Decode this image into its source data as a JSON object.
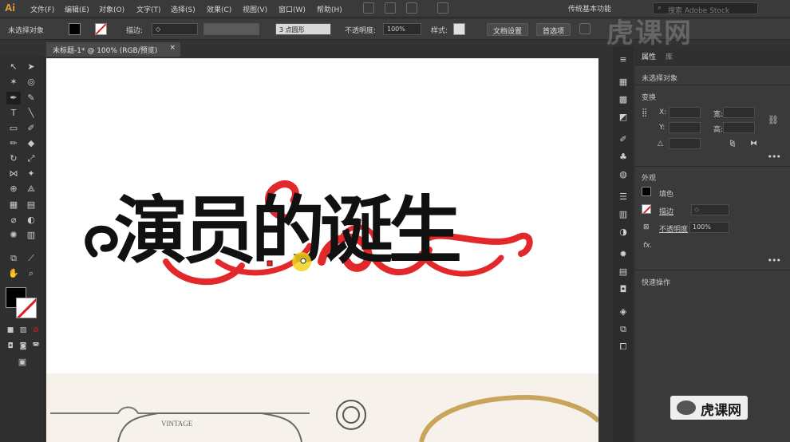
{
  "app": {
    "logo": "Ai"
  },
  "menu": [
    "文件(F)",
    "编辑(E)",
    "对象(O)",
    "文字(T)",
    "选择(S)",
    "效果(C)",
    "视图(V)",
    "窗口(W)",
    "帮助(H)"
  ],
  "workspace": "传统基本功能",
  "search": {
    "placeholder": "搜索 Adobe Stock"
  },
  "control_bar": {
    "selection_label": "未选择对象",
    "stroke_label": "描边:",
    "brush_label": "3 点圆形",
    "opacity_label": "不透明度:",
    "opacity_value": "100%",
    "style_label": "样式:",
    "doc_setup_button": "文档设置",
    "preferences_button": "首选项"
  },
  "document_tab": {
    "title": "未标题-1* @ 100% (RGB/预览)",
    "close": "×"
  },
  "canvas": {
    "artwork_text": "演员的诞生",
    "vintage_label": "VINTAGE",
    "artwork_fill": "#111111",
    "flourish_color": "#e2282a",
    "cursor_highlight": "#f2d41c"
  },
  "properties_panel": {
    "tab_properties": "属性",
    "tab_other": "库",
    "no_selection": "未选择对象",
    "transform_title": "变换",
    "x_label": "X:",
    "y_label": "Y:",
    "w_label": "宽:",
    "h_label": "高:",
    "angle_label": "△",
    "appearance_title": "外观",
    "fill_label": "填色",
    "stroke_label": "描边",
    "opacity_label": "不透明度",
    "opacity_value": "100%",
    "fx_label": "fx.",
    "quick_actions_title": "快速操作",
    "more": "•••"
  },
  "watermark": {
    "top": "虎课网",
    "bottom": "虎课网"
  },
  "colors": {
    "accent": "#e8a33b",
    "panel_bg": "#3a3a3a",
    "toolbar_bg": "#2f2f2f"
  }
}
